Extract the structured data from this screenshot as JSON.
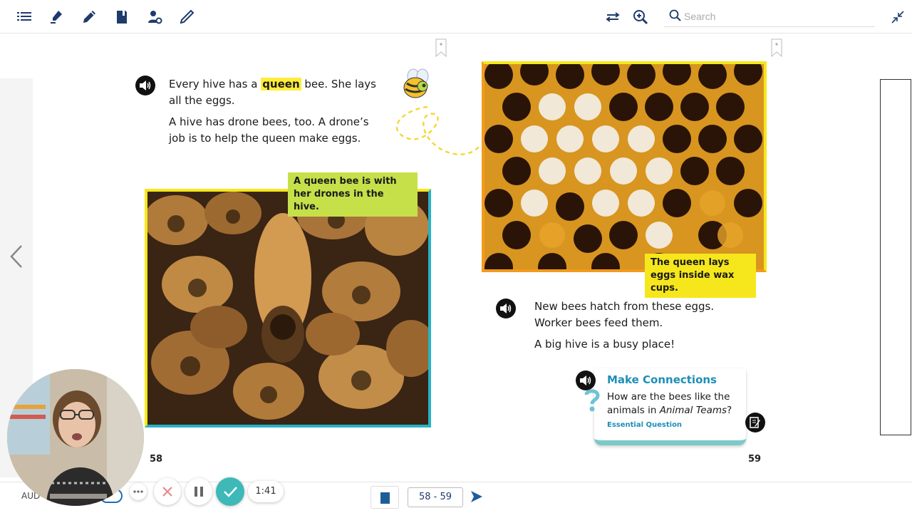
{
  "toolbar": {
    "left_icons": [
      "list-icon",
      "highlighter-icon",
      "pen-icon",
      "notebook-icon",
      "person-settings-icon",
      "pencil-icon"
    ],
    "right_icons": [
      "fit-width-icon",
      "zoom-in-icon"
    ],
    "search_placeholder": "Search",
    "collapse_icon": "collapse-icon"
  },
  "left_page": {
    "text_part1": "Every hive has a ",
    "highlight_word": "queen",
    "text_part2": " bee. She lays all the eggs.",
    "paragraph2": "A hive has drone bees, too. A drone’s job is to help the queen make eggs.",
    "caption": "A queen bee is with her drones in the hive.",
    "page_number": "58",
    "accent_color": "#f6e71c"
  },
  "right_page": {
    "caption": "The queen lays eggs inside wax cups.",
    "paragraph1": "New bees hatch from these eggs. Worker bees feed them.",
    "paragraph2": "A big hive is a busy place!",
    "page_number": "59",
    "make_connections": {
      "title": "Make Connections",
      "question_part1": "How are the bees like the animals in ",
      "question_italic": "Animal Teams",
      "question_part2": "?",
      "tag": "Essential Question"
    }
  },
  "bottom_bar": {
    "audio_label": "AUD",
    "timer": "1:41",
    "page_range": "58 - 59",
    "accent_color": "#3fb8b8"
  }
}
